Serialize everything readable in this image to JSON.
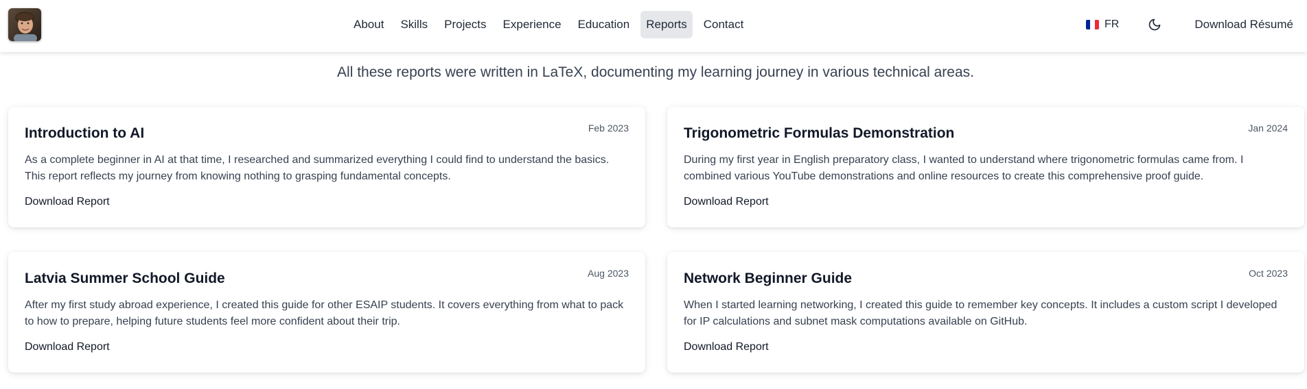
{
  "header": {
    "nav": [
      {
        "label": "About"
      },
      {
        "label": "Skills"
      },
      {
        "label": "Projects"
      },
      {
        "label": "Experience"
      },
      {
        "label": "Education"
      },
      {
        "label": "Reports",
        "active": true
      },
      {
        "label": "Contact"
      }
    ],
    "language": {
      "label": "FR",
      "icon": "french-flag-icon"
    },
    "theme_toggle": {
      "icon": "moon-icon"
    },
    "download_resume": "Download Résumé"
  },
  "main": {
    "intro": "All these reports were written in LaTeX, documenting my learning journey in various technical areas.",
    "reports": [
      {
        "title": "Introduction to AI",
        "date": "Feb 2023",
        "description": "As a complete beginner in AI at that time, I researched and summarized everything I could find to understand the basics. This report reflects my journey from knowing nothing to grasping fundamental concepts.",
        "link": "Download Report"
      },
      {
        "title": "Trigonometric Formulas Demonstration",
        "date": "Jan 2024",
        "description": "During my first year in English preparatory class, I wanted to understand where trigonometric formulas came from. I combined various YouTube demonstrations and online resources to create this comprehensive proof guide.",
        "link": "Download Report"
      },
      {
        "title": "Latvia Summer School Guide",
        "date": "Aug 2023",
        "description": "After my first study abroad experience, I created this guide for other ESAIP students. It covers everything from what to pack to how to prepare, helping future students feel more confident about their trip.",
        "link": "Download Report"
      },
      {
        "title": "Network Beginner Guide",
        "date": "Oct 2023",
        "description": "When I started learning networking, I created this guide to remember key concepts. It includes a custom script I developed for IP calculations and subnet mask computations available on GitHub.",
        "link": "Download Report"
      }
    ]
  },
  "colors": {
    "text_primary": "#111827",
    "text_secondary": "#374151",
    "nav_active_bg": "#e5e7eb",
    "flag_blue": "#002395",
    "flag_white": "#ffffff",
    "flag_red": "#ed2939"
  }
}
